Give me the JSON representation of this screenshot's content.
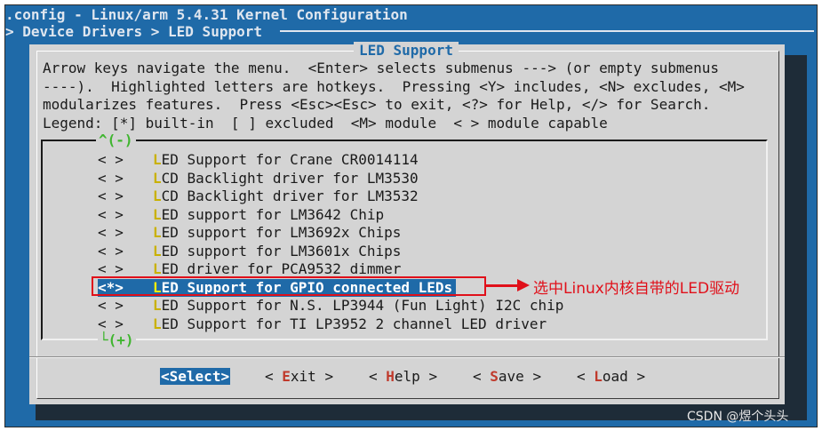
{
  "terminal": {
    "title": ".config - Linux/arm 5.4.31 Kernel Configuration",
    "breadcrumb": "> Device Drivers > LED Support"
  },
  "dialog": {
    "title": "LED Support",
    "help_lines": [
      "Arrow keys navigate the menu.  <Enter> selects submenus ---> (or empty submenus",
      "----).  Highlighted letters are hotkeys.  Pressing <Y> includes, <N> excludes, <M>",
      "modularizes features.  Press <Esc><Esc> to exit, <?> for Help, </> for Search.",
      "Legend: [*] built-in  [ ] excluded  <M> module  < > module capable"
    ],
    "scroll_up": "^(-)",
    "scroll_down": "└(+)"
  },
  "menu": {
    "items": [
      {
        "mark": "< >",
        "hot": "L",
        "rest": "ED Support for Crane CR0014114"
      },
      {
        "mark": "< >",
        "hot": "L",
        "rest": "CD Backlight driver for LM3530"
      },
      {
        "mark": "< >",
        "hot": "L",
        "rest": "CD Backlight driver for LM3532"
      },
      {
        "mark": "< >",
        "hot": "L",
        "rest": "ED support for LM3642 Chip"
      },
      {
        "mark": "< >",
        "hot": "L",
        "rest": "ED support for LM3692x Chips"
      },
      {
        "mark": "< >",
        "hot": "L",
        "rest": "ED support for LM3601x Chips"
      },
      {
        "mark": "< >",
        "hot": "L",
        "rest": "ED driver for PCA9532 dimmer"
      },
      {
        "mark": "<*>",
        "hot": "L",
        "rest": "ED Support for GPIO connected LEDs",
        "selected": true
      },
      {
        "mark": "< >",
        "hot": "L",
        "rest": "ED Support for N.S. LP3944 (Fun Light) I2C chip"
      },
      {
        "mark": "< >",
        "hot": "L",
        "rest": "ED Support for TI LP3952 2 channel LED driver"
      }
    ]
  },
  "buttons": {
    "select": {
      "pre": "<",
      "hot": "S",
      "post": "elect>"
    },
    "exit": {
      "pre": "< ",
      "hot": "E",
      "post": "xit >"
    },
    "help": {
      "pre": "< ",
      "hot": "H",
      "post": "elp >"
    },
    "save": {
      "pre": "< ",
      "hot": "S",
      "post": "ave >"
    },
    "load": {
      "pre": "< ",
      "hot": "L",
      "post": "oad >"
    }
  },
  "annotation": {
    "text": "选中Linux内核自带的LED驱动",
    "color": "#e0101a"
  },
  "watermark": "CSDN @煜个头头",
  "colors": {
    "terminal_bg": "#1f6aa8",
    "dialog_bg": "#d4d4d4",
    "hotkey": "#c9b100",
    "scroll_indicator": "#3fb52f"
  }
}
